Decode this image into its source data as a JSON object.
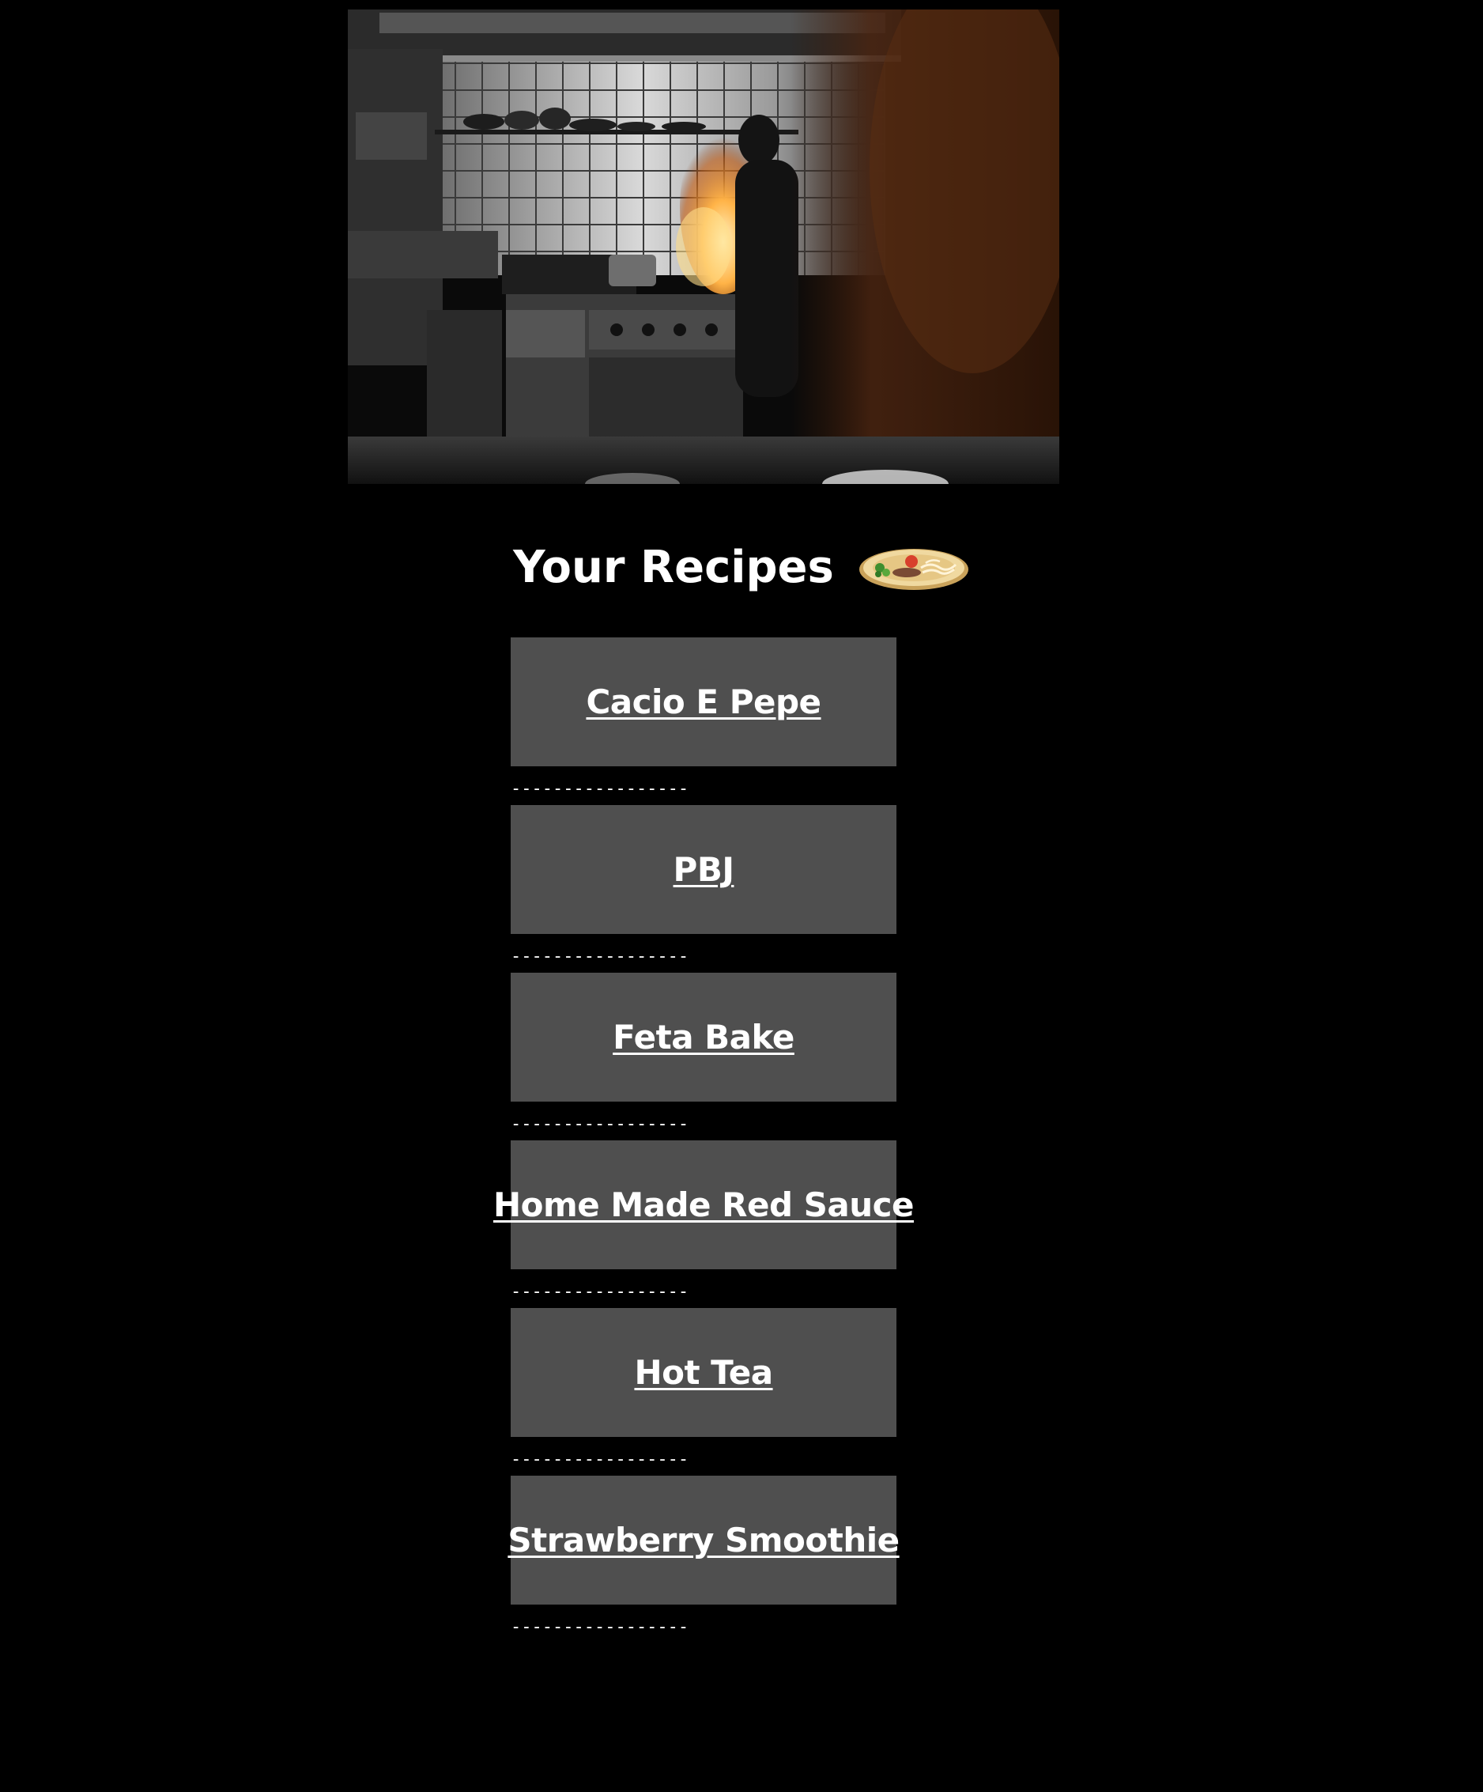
{
  "hero": {
    "image_alt": "chef cooking with flames in a restaurant kitchen"
  },
  "heading": {
    "title": "Your Recipes",
    "icon": "plate-icon"
  },
  "separator_text": "-----------------",
  "recipes": [
    {
      "label": "Cacio E Pepe"
    },
    {
      "label": "PBJ"
    },
    {
      "label": "Feta Bake"
    },
    {
      "label": "Home Made Red Sauce"
    },
    {
      "label": "Hot Tea"
    },
    {
      "label": "Strawberry Smoothie"
    }
  ],
  "colors": {
    "background": "#000000",
    "card": "#4f4f4f",
    "text": "#ffffff"
  }
}
